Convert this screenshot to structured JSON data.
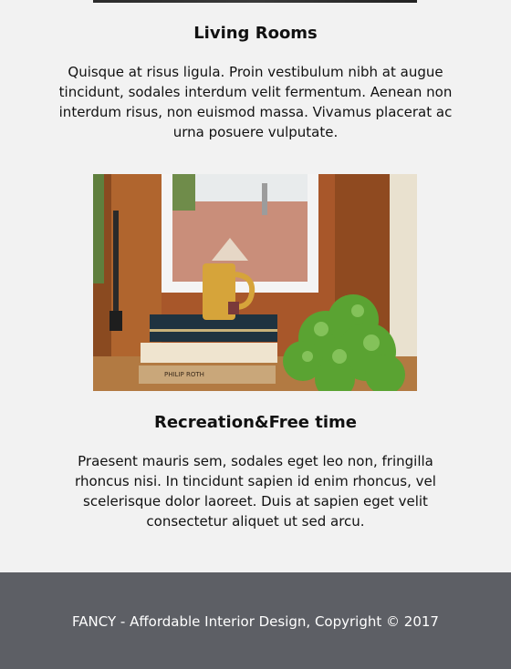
{
  "sections": [
    {
      "title": "Living Rooms",
      "text": "Quisque at risus ligula. Proin vestibulum nibh at augue tincidunt, sodales interdum velit fermentum. Aenean non interdum risus, non euismod massa. Vivamus placerat ac urna posuere vulputate."
    },
    {
      "title": "Recreation&Free time",
      "text": "Praesent mauris sem, sodales eget leo non, fringilla rhoncus nisi. In tincidunt sapien id enim rhoncus, vel scelerisque dolor laoreet. Duis at sapien eget velit consectetur aliquet ut sed arcu.",
      "image_book_label": "PHILIP ROTH"
    }
  ],
  "footer": {
    "text": "FANCY - Affordable Interior Design, Copyright © 2017"
  },
  "colors": {
    "background": "#f2f2f2",
    "footer": "#5d5f65",
    "footer_text": "#ffffff"
  }
}
